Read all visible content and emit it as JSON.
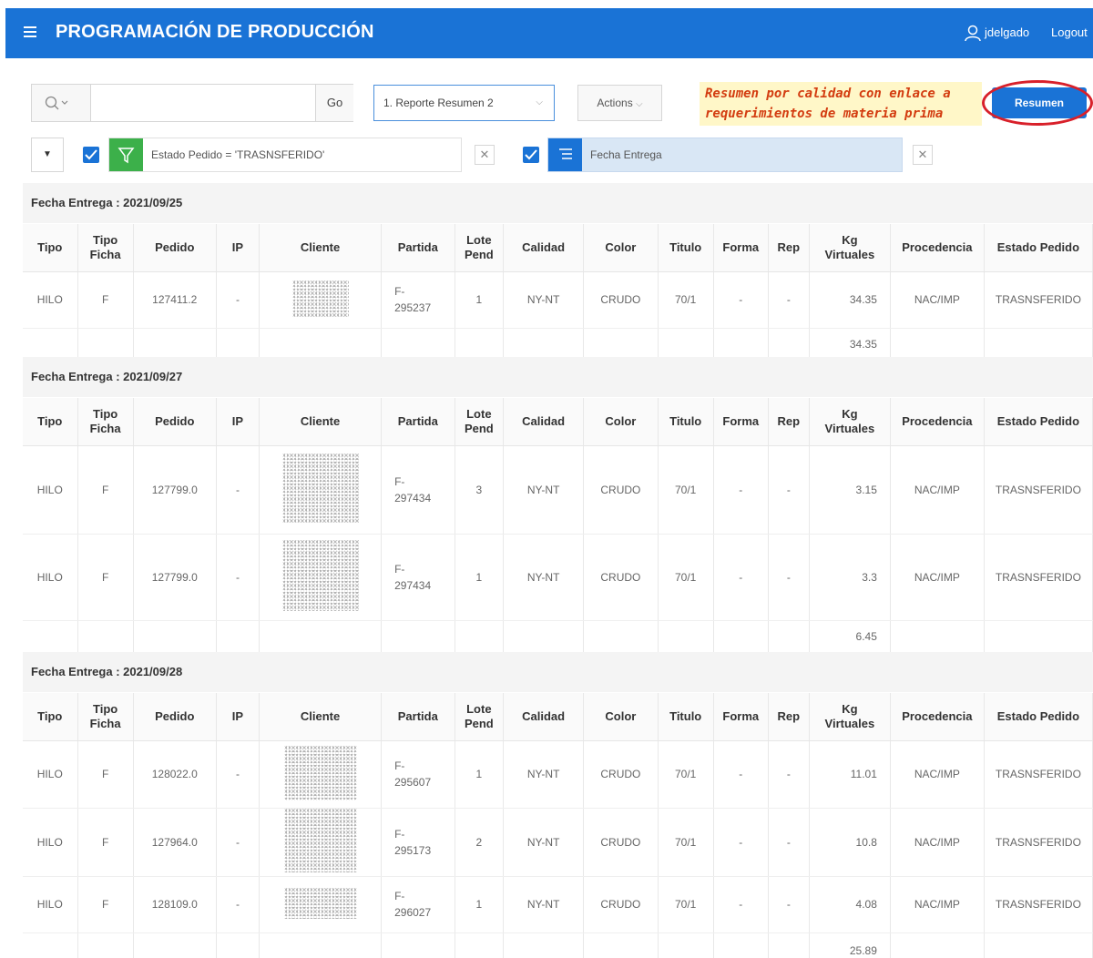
{
  "header": {
    "title": "PROGRAMACIÓN DE PRODUCCIÓN",
    "user": "jdelgado",
    "logout": "Logout"
  },
  "toolbar": {
    "search_value": "",
    "go_label": "Go",
    "report_select": "1. Reporte Resumen 2",
    "actions_label": "Actions",
    "annotation_line1": "Resumen por calidad con enlace a",
    "annotation_line2": "requerimientos de materia prima",
    "resumen_label": "Resumen"
  },
  "filters": [
    {
      "label": "Estado Pedido = 'TRASNSFERIDO'"
    },
    {
      "label": "Fecha Entrega"
    }
  ],
  "columns": [
    "Tipo",
    "Tipo Ficha",
    "Pedido",
    "IP",
    "Cliente",
    "Partida",
    "Lote Pend",
    "Calidad",
    "Color",
    "Titulo",
    "Forma",
    "Rep",
    "Kg Virtuales",
    "Procedencia",
    "Estado Pedido"
  ],
  "groups": [
    {
      "header": "Fecha Entrega : 2021/09/25",
      "rows": [
        {
          "tipo": "HILO",
          "ficha": "F",
          "pedido": "127411.2",
          "ip": "-",
          "partida1": "F-",
          "partida2": "295237",
          "lote": "1",
          "calidad": "NY-NT",
          "color": "CRUDO",
          "titulo": "70/1",
          "forma": "-",
          "rep": "-",
          "kg": "34.35",
          "proc": "NAC/IMP",
          "estado": "TRASNSFERIDO"
        }
      ],
      "total": "34.35"
    },
    {
      "header": "Fecha Entrega : 2021/09/27",
      "rows": [
        {
          "tipo": "HILO",
          "ficha": "F",
          "pedido": "127799.0",
          "ip": "-",
          "partida1": "F-",
          "partida2": "297434",
          "lote": "3",
          "calidad": "NY-NT",
          "color": "CRUDO",
          "titulo": "70/1",
          "forma": "-",
          "rep": "-",
          "kg": "3.15",
          "proc": "NAC/IMP",
          "estado": "TRASNSFERIDO"
        },
        {
          "tipo": "HILO",
          "ficha": "F",
          "pedido": "127799.0",
          "ip": "-",
          "partida1": "F-",
          "partida2": "297434",
          "lote": "1",
          "calidad": "NY-NT",
          "color": "CRUDO",
          "titulo": "70/1",
          "forma": "-",
          "rep": "-",
          "kg": "3.3",
          "proc": "NAC/IMP",
          "estado": "TRASNSFERIDO"
        }
      ],
      "total": "6.45"
    },
    {
      "header": "Fecha Entrega : 2021/09/28",
      "rows": [
        {
          "tipo": "HILO",
          "ficha": "F",
          "pedido": "128022.0",
          "ip": "-",
          "partida1": "F-",
          "partida2": "295607",
          "lote": "1",
          "calidad": "NY-NT",
          "color": "CRUDO",
          "titulo": "70/1",
          "forma": "-",
          "rep": "-",
          "kg": "11.01",
          "proc": "NAC/IMP",
          "estado": "TRASNSFERIDO"
        },
        {
          "tipo": "HILO",
          "ficha": "F",
          "pedido": "127964.0",
          "ip": "-",
          "partida1": "F-",
          "partida2": "295173",
          "lote": "2",
          "calidad": "NY-NT",
          "color": "CRUDO",
          "titulo": "70/1",
          "forma": "-",
          "rep": "-",
          "kg": "10.8",
          "proc": "NAC/IMP",
          "estado": "TRASNSFERIDO"
        },
        {
          "tipo": "HILO",
          "ficha": "F",
          "pedido": "128109.0",
          "ip": "-",
          "partida1": "F-",
          "partida2": "296027",
          "lote": "1",
          "calidad": "NY-NT",
          "color": "CRUDO",
          "titulo": "70/1",
          "forma": "-",
          "rep": "-",
          "kg": "4.08",
          "proc": "NAC/IMP",
          "estado": "TRASNSFERIDO"
        }
      ],
      "total": "25.89"
    }
  ]
}
